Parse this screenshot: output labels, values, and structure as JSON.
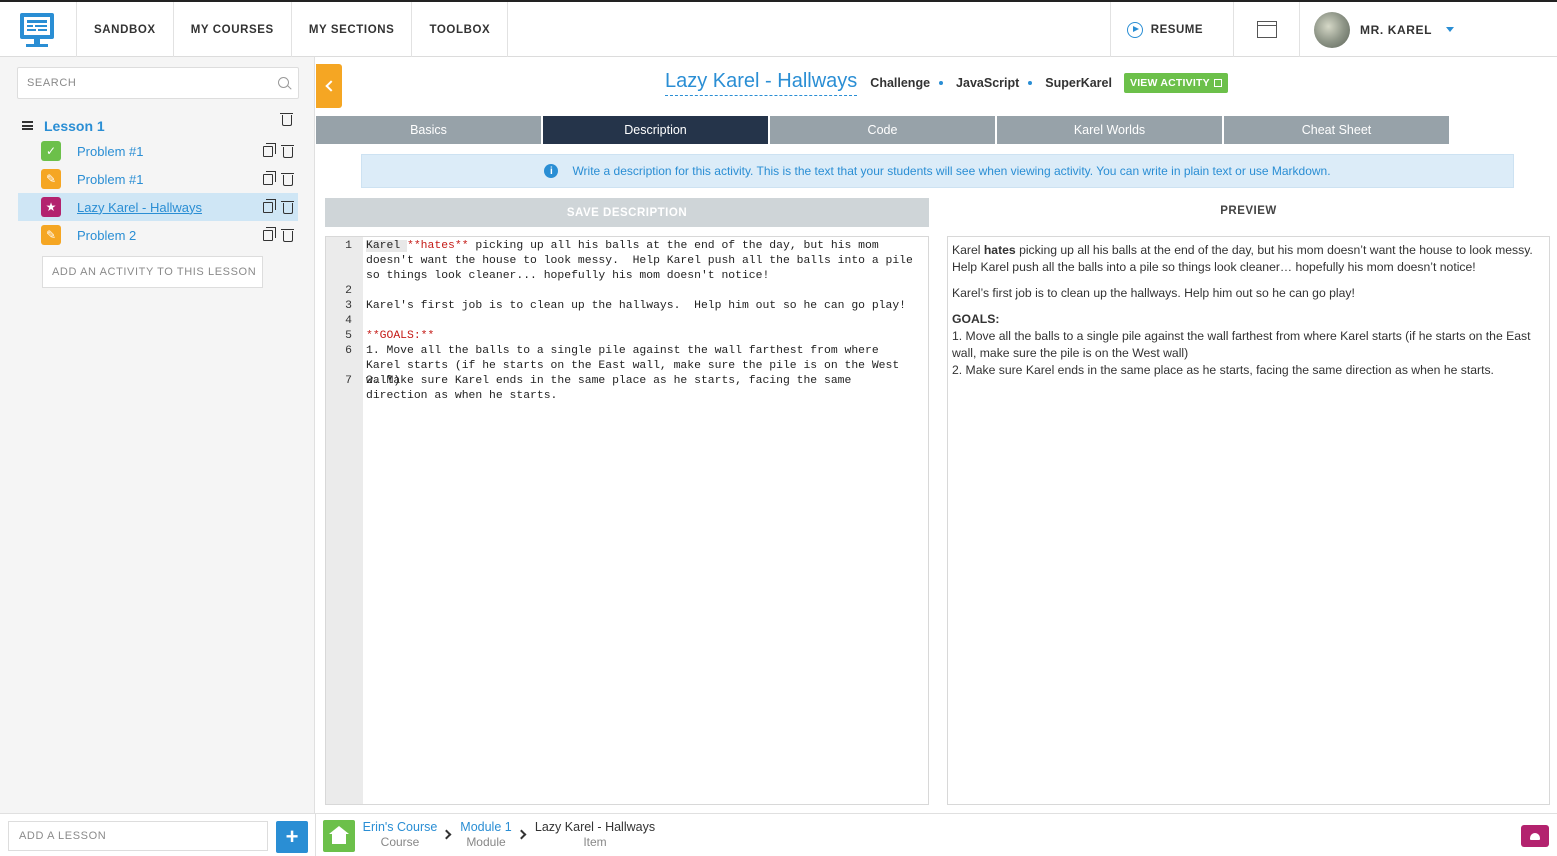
{
  "nav": {
    "items": [
      "SANDBOX",
      "MY COURSES",
      "MY SECTIONS",
      "TOOLBOX"
    ],
    "resume_label": "RESUME",
    "username": "MR. KAREL"
  },
  "sidebar": {
    "search_placeholder": "SEARCH",
    "lesson_title": "Lesson 1",
    "items": [
      {
        "label": "Problem #1",
        "icon": "checkbox-icon",
        "color": "#6cc04a"
      },
      {
        "label": "Problem #1",
        "icon": "pencil-icon",
        "color": "#f5a623"
      },
      {
        "label": "Lazy Karel - Hallways",
        "icon": "star-icon",
        "color": "#b3226e",
        "active": true
      },
      {
        "label": "Problem 2",
        "icon": "pencil-icon",
        "color": "#f5a623"
      }
    ],
    "add_activity_label": "ADD AN ACTIVITY TO THIS LESSON",
    "add_lesson_placeholder": "ADD A LESSON"
  },
  "activity": {
    "title": "Lazy Karel - Hallways",
    "type": "Challenge",
    "language": "JavaScript",
    "variant": "SuperKarel",
    "view_label": "VIEW ACTIVITY"
  },
  "tabs": [
    "Basics",
    "Description",
    "Code",
    "Karel Worlds",
    "Cheat Sheet"
  ],
  "active_tab": "Description",
  "info_text": "Write a description for this activity. This is the text that your students will see when viewing activity. You can write in plain text or use Markdown.",
  "save_label": "SAVE DESCRIPTION",
  "preview_label": "PREVIEW",
  "editor": {
    "lines": [
      {
        "num": "1",
        "pre": "Karel ",
        "red": "**hates**",
        "post": " picking up all his balls at the end of the day, but his mom doesn't want the house to look messy.  Help Karel push all the balls into a pile so things look cleaner... hopefully his mom doesn't notice!"
      },
      {
        "num": "2",
        "pre": "",
        "red": "",
        "post": ""
      },
      {
        "num": "3",
        "pre": "Karel's first job is to clean up the hallways.  Help him out so he can go play!",
        "red": "",
        "post": ""
      },
      {
        "num": "4",
        "pre": "",
        "red": "",
        "post": ""
      },
      {
        "num": "5",
        "pre": "",
        "red": "**GOALS:**",
        "post": ""
      },
      {
        "num": "6",
        "pre": "1. Move all the balls to a single pile against the wall farthest from where Karel starts (if he starts on the East wall, make sure the pile is on the West wall)",
        "red": "",
        "post": ""
      },
      {
        "num": "7",
        "pre": "2. Make sure Karel ends in the same place as he starts, facing the same direction as when he starts.",
        "red": "",
        "post": ""
      }
    ]
  },
  "preview": {
    "p1_pre": "Karel ",
    "p1_bold": "hates",
    "p1_post": " picking up all his balls at the end of the day, but his mom doesn’t want the house to look messy. Help Karel push all the balls into a pile so things look cleaner… hopefully his mom doesn’t notice!",
    "p2": "Karel’s first job is to clean up the hallways. Help him out so he can go play!",
    "goals_title": "GOALS:",
    "goal1": "1. Move all the balls to a single pile against the wall farthest from where Karel starts (if he starts on the East wall, make sure the pile is on the West wall)",
    "goal2": "2. Make sure Karel ends in the same place as he starts, facing the same direction as when he starts."
  },
  "breadcrumb": [
    {
      "name": "Erin's Course",
      "kind": "Course"
    },
    {
      "name": "Module 1",
      "kind": "Module"
    },
    {
      "name": "Lazy Karel - Hallways",
      "kind": "Item"
    }
  ],
  "colors": {
    "accent": "#2a8ed4",
    "green": "#6cc04a",
    "orange": "#f5a623",
    "magenta": "#b3226e",
    "dark_tab": "#25344a"
  }
}
